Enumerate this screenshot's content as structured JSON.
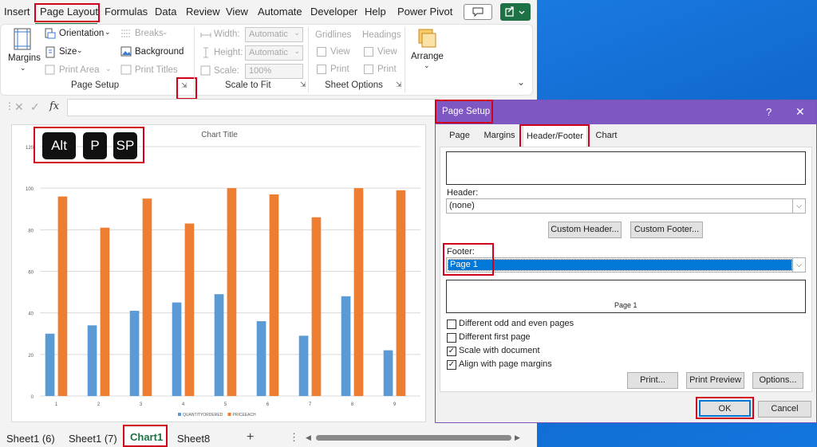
{
  "ribbon_tabs": [
    "Insert",
    "Page Layout",
    "Formulas",
    "Data",
    "Review",
    "View",
    "Automate",
    "Developer",
    "Help",
    "Power Pivot"
  ],
  "page_setup_group": {
    "margins": "Margins",
    "orientation": "Orientation",
    "size": "Size",
    "print_area": "Print Area",
    "breaks": "Breaks",
    "background": "Background",
    "print_titles": "Print Titles",
    "title": "Page Setup"
  },
  "scale_group": {
    "width_label": "Width:",
    "height_label": "Height:",
    "scale_label": "Scale:",
    "width_value": "Automatic",
    "height_value": "Automatic",
    "scale_value": "100%",
    "title": "Scale to Fit"
  },
  "sheet_options": {
    "gridlines": "Gridlines",
    "headings": "Headings",
    "view": "View",
    "print": "Print",
    "title": "Sheet Options"
  },
  "arrange": "Arrange",
  "formula_bar": {
    "fx": "fx"
  },
  "shortcut_keys": [
    "Alt",
    "P",
    "SP"
  ],
  "chart_data": {
    "type": "bar",
    "title": "Chart Title",
    "categories": [
      "1",
      "2",
      "3",
      "4",
      "5",
      "6",
      "7",
      "8",
      "9"
    ],
    "series": [
      {
        "name": "QUANTITYORDERED",
        "values": [
          30,
          34,
          41,
          45,
          49,
          36,
          29,
          48,
          22
        ],
        "color": "#5b9bd5"
      },
      {
        "name": "PRICEEACH",
        "values": [
          96,
          81,
          95,
          83,
          100,
          97,
          86,
          100,
          99
        ],
        "color": "#ed7d31"
      }
    ],
    "yticks": [
      "0",
      "20",
      "40",
      "60",
      "80",
      "100",
      "120"
    ],
    "ylim": [
      0,
      120
    ],
    "grid": true,
    "legend": "bottom"
  },
  "sheet_tabs": [
    "Sheet1 (6)",
    "Sheet1 (7)",
    "Chart1",
    "Sheet8"
  ],
  "add_sheet": "+",
  "dialog": {
    "title": "Page Setup",
    "help": "?",
    "close": "✕",
    "tabs": [
      "Page",
      "Margins",
      "Header/Footer",
      "Chart"
    ],
    "header_label": "Header:",
    "header_value": "(none)",
    "custom_header": "Custom Header...",
    "custom_footer": "Custom Footer...",
    "footer_label": "Footer:",
    "footer_value": "Page 1",
    "footer_preview": "Page 1",
    "checkboxes": [
      {
        "label": "Different odd and even pages",
        "checked": false
      },
      {
        "label": "Different first page",
        "checked": false
      },
      {
        "label": "Scale with document",
        "checked": true
      },
      {
        "label": "Align with page margins",
        "checked": true
      }
    ],
    "print": "Print...",
    "print_preview": "Print Preview",
    "options": "Options...",
    "ok": "OK",
    "cancel": "Cancel"
  }
}
